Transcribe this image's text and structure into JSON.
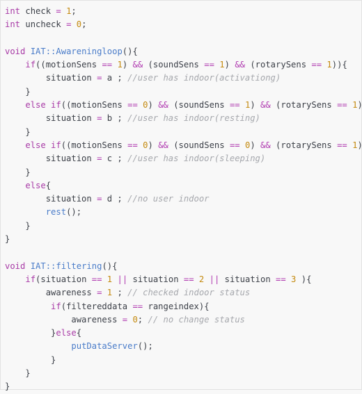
{
  "colors": {
    "keyword": "#a83aa6",
    "function": "#4a7cc9",
    "number": "#c48a0f",
    "comment": "#a6a8ad",
    "text": "#3b3f47",
    "background": "#f8f8f8"
  },
  "code_lines": [
    [
      {
        "t": "kw",
        "v": "int"
      },
      {
        "t": "tx",
        "v": " check "
      },
      {
        "t": "op",
        "v": "="
      },
      {
        "t": "tx",
        "v": " "
      },
      {
        "t": "num",
        "v": "1"
      },
      {
        "t": "tx",
        "v": ";"
      }
    ],
    [
      {
        "t": "kw",
        "v": "int"
      },
      {
        "t": "tx",
        "v": " uncheck "
      },
      {
        "t": "op",
        "v": "="
      },
      {
        "t": "tx",
        "v": " "
      },
      {
        "t": "num",
        "v": "0"
      },
      {
        "t": "tx",
        "v": ";"
      }
    ],
    [],
    [
      {
        "t": "kw",
        "v": "void"
      },
      {
        "t": "tx",
        "v": " "
      },
      {
        "t": "fn",
        "v": "IAT::Awareningloop"
      },
      {
        "t": "tx",
        "v": "(){"
      }
    ],
    [
      {
        "t": "tx",
        "v": "    "
      },
      {
        "t": "kw",
        "v": "if"
      },
      {
        "t": "tx",
        "v": "((motionSens "
      },
      {
        "t": "op",
        "v": "=="
      },
      {
        "t": "tx",
        "v": " "
      },
      {
        "t": "num",
        "v": "1"
      },
      {
        "t": "tx",
        "v": ") "
      },
      {
        "t": "op",
        "v": "&&"
      },
      {
        "t": "tx",
        "v": " (soundSens "
      },
      {
        "t": "op",
        "v": "=="
      },
      {
        "t": "tx",
        "v": " "
      },
      {
        "t": "num",
        "v": "1"
      },
      {
        "t": "tx",
        "v": ") "
      },
      {
        "t": "op",
        "v": "&&"
      },
      {
        "t": "tx",
        "v": " (rotarySens "
      },
      {
        "t": "op",
        "v": "=="
      },
      {
        "t": "tx",
        "v": " "
      },
      {
        "t": "num",
        "v": "1"
      },
      {
        "t": "tx",
        "v": ")){"
      }
    ],
    [
      {
        "t": "tx",
        "v": "        situation "
      },
      {
        "t": "op",
        "v": "="
      },
      {
        "t": "tx",
        "v": " a ; "
      },
      {
        "t": "cm",
        "v": "//user has indoor(activationg)"
      }
    ],
    [
      {
        "t": "tx",
        "v": "    }"
      }
    ],
    [
      {
        "t": "tx",
        "v": "    "
      },
      {
        "t": "kw",
        "v": "else if"
      },
      {
        "t": "tx",
        "v": "((motionSens "
      },
      {
        "t": "op",
        "v": "=="
      },
      {
        "t": "tx",
        "v": " "
      },
      {
        "t": "num",
        "v": "0"
      },
      {
        "t": "tx",
        "v": ") "
      },
      {
        "t": "op",
        "v": "&&"
      },
      {
        "t": "tx",
        "v": " (soundSens "
      },
      {
        "t": "op",
        "v": "=="
      },
      {
        "t": "tx",
        "v": " "
      },
      {
        "t": "num",
        "v": "1"
      },
      {
        "t": "tx",
        "v": ") "
      },
      {
        "t": "op",
        "v": "&&"
      },
      {
        "t": "tx",
        "v": " (rotarySens "
      },
      {
        "t": "op",
        "v": "=="
      },
      {
        "t": "tx",
        "v": " "
      },
      {
        "t": "num",
        "v": "1"
      },
      {
        "t": "tx",
        "v": ")){"
      }
    ],
    [
      {
        "t": "tx",
        "v": "        situation "
      },
      {
        "t": "op",
        "v": "="
      },
      {
        "t": "tx",
        "v": " b ; "
      },
      {
        "t": "cm",
        "v": "//user has indoor(resting)"
      }
    ],
    [
      {
        "t": "tx",
        "v": "    }"
      }
    ],
    [
      {
        "t": "tx",
        "v": "    "
      },
      {
        "t": "kw",
        "v": "else if"
      },
      {
        "t": "tx",
        "v": "((motionSens "
      },
      {
        "t": "op",
        "v": "=="
      },
      {
        "t": "tx",
        "v": " "
      },
      {
        "t": "num",
        "v": "0"
      },
      {
        "t": "tx",
        "v": ") "
      },
      {
        "t": "op",
        "v": "&&"
      },
      {
        "t": "tx",
        "v": " (soundSens "
      },
      {
        "t": "op",
        "v": "=="
      },
      {
        "t": "tx",
        "v": " "
      },
      {
        "t": "num",
        "v": "0"
      },
      {
        "t": "tx",
        "v": ") "
      },
      {
        "t": "op",
        "v": "&&"
      },
      {
        "t": "tx",
        "v": " (rotarySens "
      },
      {
        "t": "op",
        "v": "=="
      },
      {
        "t": "tx",
        "v": " "
      },
      {
        "t": "num",
        "v": "1"
      },
      {
        "t": "tx",
        "v": ")){"
      }
    ],
    [
      {
        "t": "tx",
        "v": "        situation "
      },
      {
        "t": "op",
        "v": "="
      },
      {
        "t": "tx",
        "v": " c ; "
      },
      {
        "t": "cm",
        "v": "//user has indoor(sleeping)"
      }
    ],
    [
      {
        "t": "tx",
        "v": "    }"
      }
    ],
    [
      {
        "t": "tx",
        "v": "    "
      },
      {
        "t": "kw",
        "v": "else"
      },
      {
        "t": "tx",
        "v": "{"
      }
    ],
    [
      {
        "t": "tx",
        "v": "        situation "
      },
      {
        "t": "op",
        "v": "="
      },
      {
        "t": "tx",
        "v": " d ; "
      },
      {
        "t": "cm",
        "v": "//no user indoor"
      }
    ],
    [
      {
        "t": "tx",
        "v": "        "
      },
      {
        "t": "fn",
        "v": "rest"
      },
      {
        "t": "tx",
        "v": "();"
      }
    ],
    [
      {
        "t": "tx",
        "v": "    }"
      }
    ],
    [
      {
        "t": "tx",
        "v": "}"
      }
    ],
    [],
    [
      {
        "t": "kw",
        "v": "void"
      },
      {
        "t": "tx",
        "v": " "
      },
      {
        "t": "fn",
        "v": "IAT::filtering"
      },
      {
        "t": "tx",
        "v": "(){"
      }
    ],
    [
      {
        "t": "tx",
        "v": "    "
      },
      {
        "t": "kw",
        "v": "if"
      },
      {
        "t": "tx",
        "v": "(situation "
      },
      {
        "t": "op",
        "v": "=="
      },
      {
        "t": "tx",
        "v": " "
      },
      {
        "t": "num",
        "v": "1"
      },
      {
        "t": "tx",
        "v": " "
      },
      {
        "t": "op",
        "v": "||"
      },
      {
        "t": "tx",
        "v": " situation "
      },
      {
        "t": "op",
        "v": "=="
      },
      {
        "t": "tx",
        "v": " "
      },
      {
        "t": "num",
        "v": "2"
      },
      {
        "t": "tx",
        "v": " "
      },
      {
        "t": "op",
        "v": "||"
      },
      {
        "t": "tx",
        "v": " situation "
      },
      {
        "t": "op",
        "v": "=="
      },
      {
        "t": "tx",
        "v": " "
      },
      {
        "t": "num",
        "v": "3"
      },
      {
        "t": "tx",
        "v": " ){"
      }
    ],
    [
      {
        "t": "tx",
        "v": "        awareness "
      },
      {
        "t": "op",
        "v": "="
      },
      {
        "t": "tx",
        "v": " "
      },
      {
        "t": "num",
        "v": "1"
      },
      {
        "t": "tx",
        "v": " ; "
      },
      {
        "t": "cm",
        "v": "// checked indoor status"
      }
    ],
    [
      {
        "t": "tx",
        "v": "         "
      },
      {
        "t": "kw",
        "v": "if"
      },
      {
        "t": "tx",
        "v": "(filtereddata "
      },
      {
        "t": "op",
        "v": "=="
      },
      {
        "t": "tx",
        "v": " rangeindex){"
      }
    ],
    [
      {
        "t": "tx",
        "v": "             awareness "
      },
      {
        "t": "op",
        "v": "="
      },
      {
        "t": "tx",
        "v": " "
      },
      {
        "t": "num",
        "v": "0"
      },
      {
        "t": "tx",
        "v": "; "
      },
      {
        "t": "cm",
        "v": "// no change status"
      }
    ],
    [
      {
        "t": "tx",
        "v": "         }"
      },
      {
        "t": "kw",
        "v": "else"
      },
      {
        "t": "tx",
        "v": "{"
      }
    ],
    [
      {
        "t": "tx",
        "v": "             "
      },
      {
        "t": "fn",
        "v": "putDataServer"
      },
      {
        "t": "tx",
        "v": "();"
      }
    ],
    [
      {
        "t": "tx",
        "v": "         }"
      }
    ],
    [
      {
        "t": "tx",
        "v": "    }"
      }
    ],
    [
      {
        "t": "tx",
        "v": "}"
      }
    ]
  ]
}
